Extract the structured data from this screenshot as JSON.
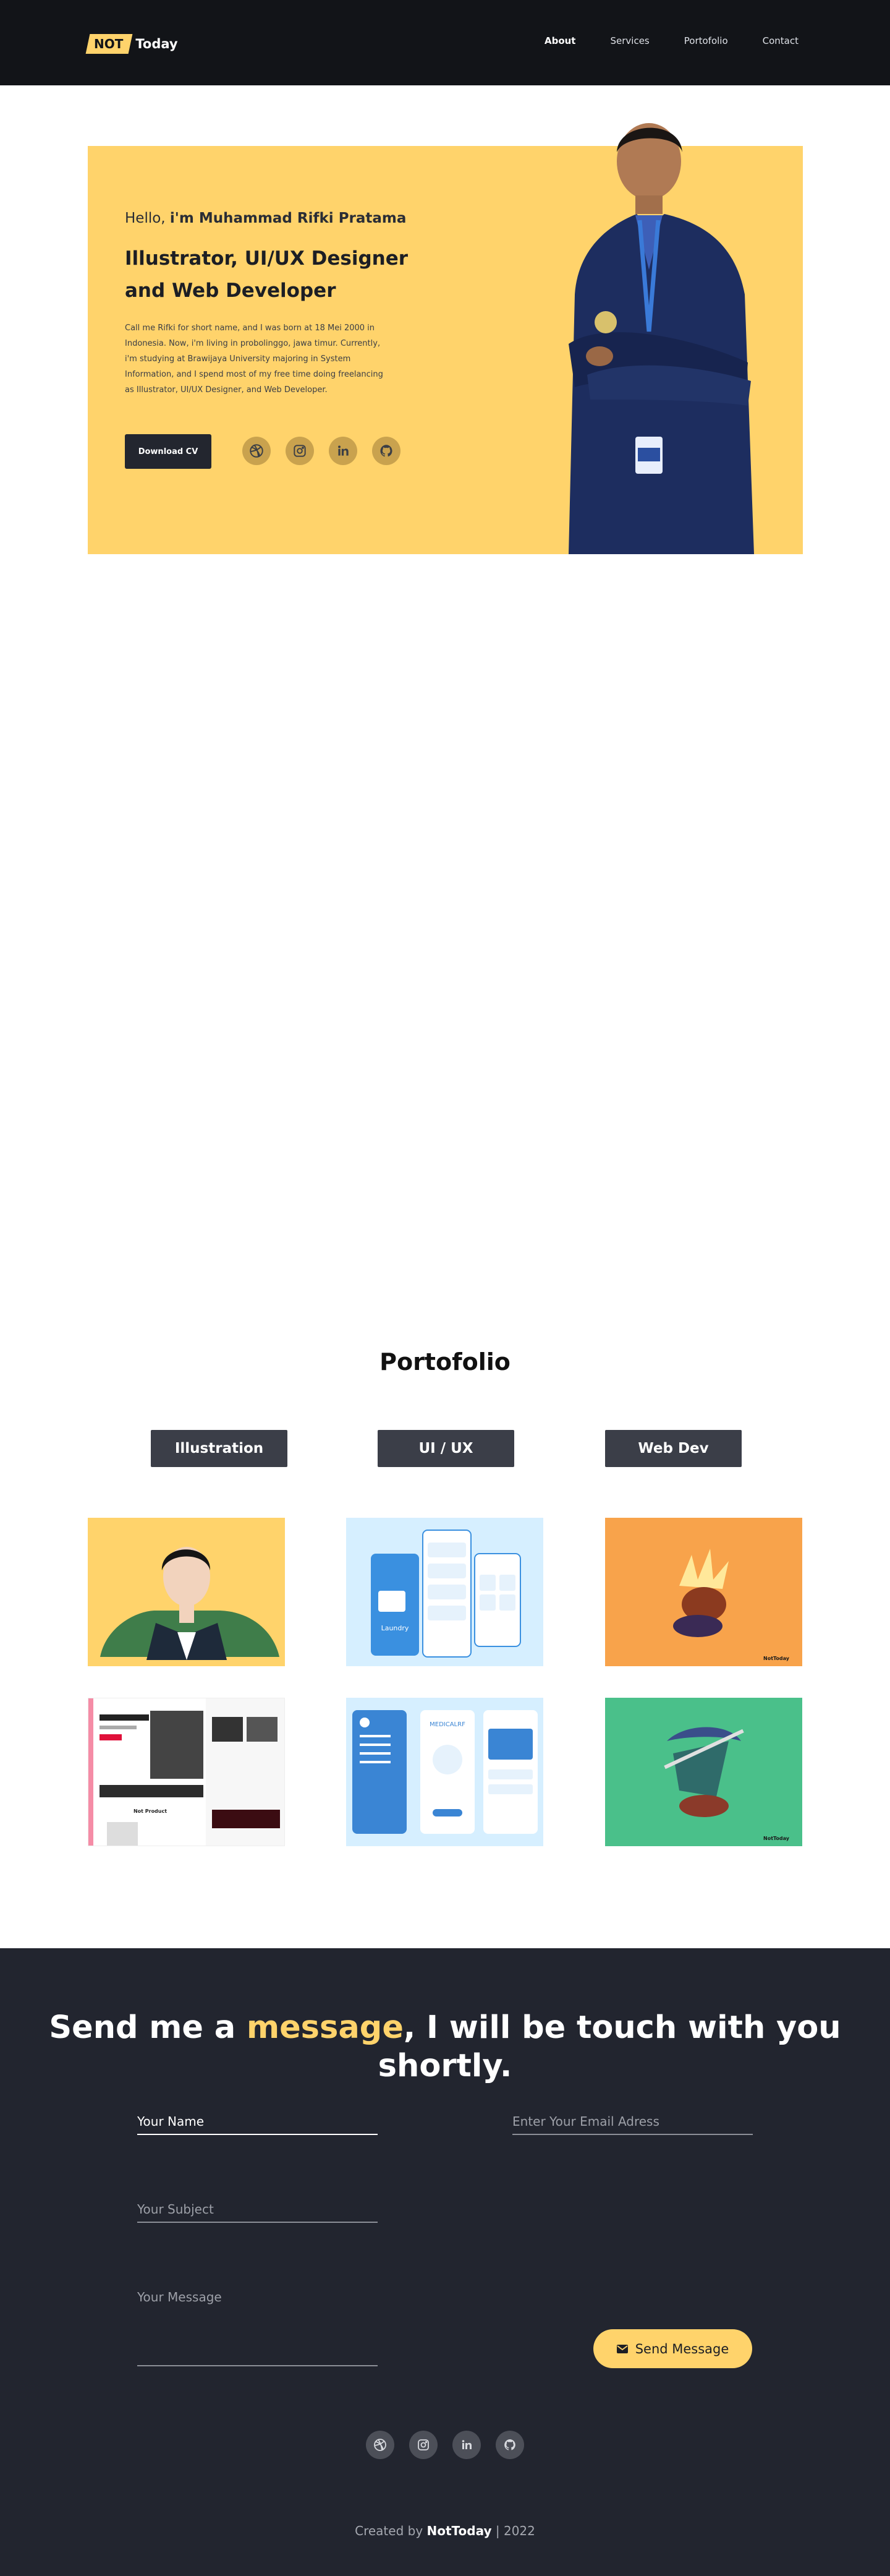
{
  "header": {
    "logo_not": "NOT",
    "logo_today": "Today",
    "nav": [
      "About",
      "Services",
      "Portofolio",
      "Contact"
    ],
    "active_nav": "About"
  },
  "hero": {
    "hello_prefix": "Hello,",
    "hello_name": "i'm Muhammad Rifki Pratama",
    "title": "Illustrator, UI/UX Designer and Web Developer",
    "description": "Call me Rifki for short name, and I was born at 18 Mei 2000 in Indonesia. Now, i'm living in probolinggo, jawa timur. Currently, i'm studying at Brawijaya University majoring in System Information, and I spend most of my free time doing freelancing as Illustrator, UI/UX Designer, and Web Developer.",
    "cv_button": "Download CV",
    "social_icons": [
      "dribbble-icon",
      "instagram-icon",
      "linkedin-icon",
      "github-icon"
    ]
  },
  "portfolio": {
    "title": "Portofolio",
    "tabs": [
      "Illustration",
      "UI / UX",
      "Web Dev"
    ],
    "tiles": [
      {
        "kind": "illustration-portrait",
        "bg": "#ffd36b"
      },
      {
        "kind": "ui-laundry-app",
        "bg": "#d6efff",
        "label": "Laundry"
      },
      {
        "kind": "illustration-warrior",
        "bg": "#f8a34b",
        "label": "NotToday"
      },
      {
        "kind": "web-clothing-site",
        "bg": "#ffffff",
        "label": "Not Product"
      },
      {
        "kind": "ui-medical-app",
        "bg": "#d6efff",
        "label": "MEDICALRF"
      },
      {
        "kind": "illustration-swordsman",
        "bg": "#4ac08a",
        "label": "NotToday"
      }
    ]
  },
  "contact": {
    "heading_part1": "Send me a",
    "heading_highlight": "message",
    "heading_part2": ", I will be touch with you shortly.",
    "name_placeholder": "Your Name",
    "email_placeholder": "Enter Your Email Adress",
    "subject_placeholder": "Your Subject",
    "message_placeholder": "Your Message",
    "send_button": "Send Message",
    "social_icons": [
      "dribbble-icon",
      "instagram-icon",
      "linkedin-icon",
      "github-icon"
    ]
  },
  "footer": {
    "credit_prefix": "Created by",
    "credit_name": "NotToday",
    "credit_suffix": "| 2022"
  },
  "colors": {
    "accent": "#ffd36b",
    "dark": "#121418",
    "contact_bg": "#22252f"
  }
}
